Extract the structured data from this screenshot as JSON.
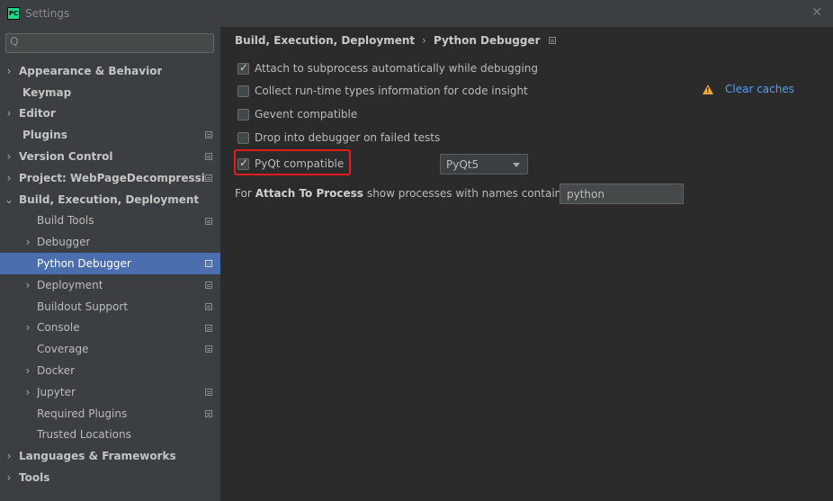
{
  "window": {
    "icon_text": "PC",
    "title": "Settings",
    "close_glyph": "✕"
  },
  "search": {
    "icon_glyph": "Q",
    "value": "",
    "placeholder": ""
  },
  "tree": [
    {
      "label": "Appearance & Behavior",
      "arrow": "›",
      "bold": true
    },
    {
      "label": "Keymap",
      "arrow": "",
      "bold": true
    },
    {
      "label": "Editor",
      "arrow": "›",
      "bold": true
    },
    {
      "label": "Plugins",
      "arrow": "",
      "bold": true,
      "cfg": true
    },
    {
      "label": "Version Control",
      "arrow": "›",
      "bold": true,
      "cfg": true
    },
    {
      "label": "Project: WebPageDecompressionE",
      "arrow": "›",
      "bold": true,
      "cfg": true
    },
    {
      "label": "Build, Execution, Deployment",
      "arrow": "⌄",
      "bold": true
    },
    {
      "label": "Build Tools",
      "arrow": "",
      "cfg": true
    },
    {
      "label": "Debugger",
      "arrow": "›"
    },
    {
      "label": "Python Debugger",
      "arrow": "",
      "cfg": true,
      "selected": true
    },
    {
      "label": "Deployment",
      "arrow": "›",
      "cfg": true
    },
    {
      "label": "Buildout Support",
      "arrow": "",
      "cfg": true
    },
    {
      "label": "Console",
      "arrow": "›",
      "cfg": true
    },
    {
      "label": "Coverage",
      "arrow": "",
      "cfg": true
    },
    {
      "label": "Docker",
      "arrow": "›"
    },
    {
      "label": "Jupyter",
      "arrow": "›",
      "cfg": true
    },
    {
      "label": "Required Plugins",
      "arrow": "",
      "cfg": true
    },
    {
      "label": "Trusted Locations",
      "arrow": ""
    },
    {
      "label": "Languages & Frameworks",
      "arrow": "›",
      "bold": true
    },
    {
      "label": "Tools",
      "arrow": "›",
      "bold": true
    }
  ],
  "breadcrumb": {
    "parent": "Build, Execution, Deployment",
    "separator": "›",
    "current": "Python Debugger"
  },
  "options": [
    {
      "label": "Attach to subprocess automatically while debugging",
      "checked": true
    },
    {
      "label": "Collect run-time types information for code insight",
      "checked": false
    },
    {
      "label": "Gevent compatible",
      "checked": false
    },
    {
      "label": "Drop into debugger on failed tests",
      "checked": false
    },
    {
      "label": "PyQt compatible",
      "checked": true
    }
  ],
  "clear_caches": {
    "warning_glyph": "!",
    "label": "Clear caches"
  },
  "pyqt_combo": {
    "value": "PyQt5"
  },
  "attach_process": {
    "prefix": "For",
    "bold": "Attach To Process",
    "suffix": "show processes with names containing:",
    "value": "python"
  },
  "colors": {
    "selection": "#4b6eaf",
    "link": "#589df6",
    "highlight_border": "#e51c1c",
    "warning": "#f0a732"
  }
}
